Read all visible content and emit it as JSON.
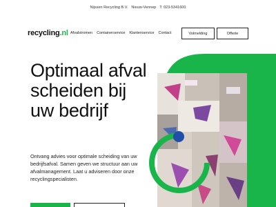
{
  "topbar": {
    "company": "Nijssen Recycling B.V.",
    "city": "Nieuw-Vennep",
    "phone": "T: 023-5341600"
  },
  "logo": {
    "main": "recycling",
    "suffix": ".nl"
  },
  "nav": {
    "items": [
      {
        "label": "Afvalstromen"
      },
      {
        "label": "Containerservice"
      },
      {
        "label": "Klantenservice"
      },
      {
        "label": "Contact"
      }
    ],
    "report_label": "Volmelding",
    "quote_label": "Offerte"
  },
  "hero": {
    "title": "Optimaal afval scheiden bij uw bedrijf",
    "text": "Ontvang advies voor optimale scheiding van uw bedrijfsafval. Samen geven we structuur aan uw afvalmanagement. Laat u adviseren door onze recyclingspecialisten."
  },
  "colors": {
    "accent": "#19b54a",
    "dot": "#1f4fa8"
  }
}
